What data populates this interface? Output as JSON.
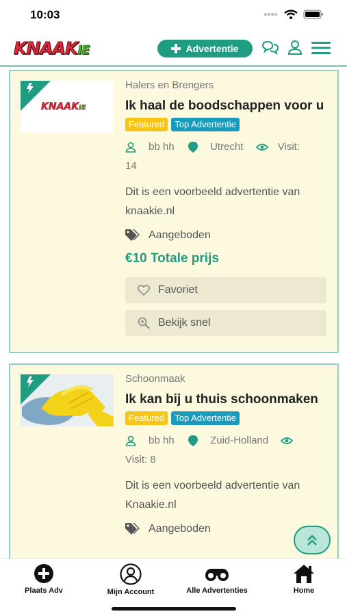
{
  "status": {
    "time": "10:03"
  },
  "header": {
    "logo_main": "KNAAK",
    "logo_suffix": "IE",
    "advert_button": "Advertentie"
  },
  "cards": [
    {
      "image_logo_text": "KNAAK",
      "image_logo_suffix": "IE",
      "category": "Halers en Brengers",
      "title": "Ik haal de boodschappen voor u",
      "badges": [
        "Featured",
        "Top Advertentie"
      ],
      "user": "bb hh",
      "location": "Utrecht",
      "visits_label": "Visit:",
      "visits": "14",
      "description": "Dit is een voorbeeld advertentie van knaakie.nl",
      "offer_type": "Aangeboden",
      "price": "€10 Totale prijs",
      "favorite_label": "Favoriet",
      "quickview_label": "Bekijk snel"
    },
    {
      "category": "Schoonmaak",
      "title": "Ik kan bij u thuis schoonmaken",
      "badges": [
        "Featured",
        "Top Advertentie"
      ],
      "user": "bb hh",
      "location": "Zuid-Holland",
      "visits_label": "Visit:",
      "visits": "8",
      "description": "Dit is een voorbeeld advertentie van Knaakie.nl",
      "offer_type": "Aangeboden"
    }
  ],
  "bottom_nav": [
    {
      "label": "Plaats Adv",
      "icon": "plus-circle-icon"
    },
    {
      "label": "Mijn Account",
      "icon": "account-icon"
    },
    {
      "label": "Alle Advertenties",
      "icon": "binoculars-icon"
    },
    {
      "label": "Home",
      "icon": "home-icon"
    }
  ],
  "colors": {
    "accent": "#1f9c82",
    "card_bg": "#fcf9de",
    "featured": "#f5c518",
    "top": "#1a9bbd",
    "logo_red": "#e02a3b"
  }
}
